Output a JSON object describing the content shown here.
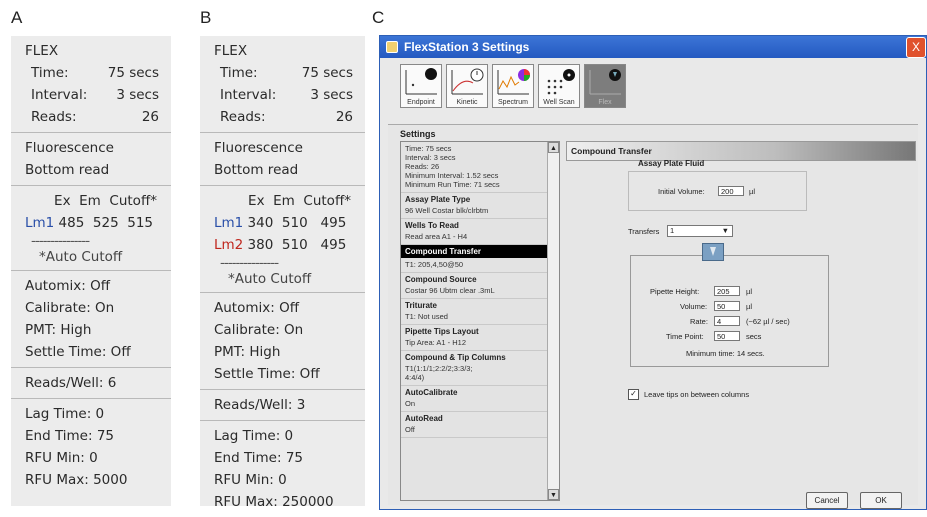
{
  "panel_letters": [
    "A",
    "B",
    "C"
  ],
  "panel_a": {
    "flex": "FLEX",
    "time_label": "Time:",
    "time_value": "75 secs",
    "interval_label": "Interval:",
    "interval_value": "3 secs",
    "reads_label": "Reads:",
    "reads_value": "26",
    "mode1": "Fluorescence",
    "mode2": "Bottom read",
    "header": "Ex  Em  Cutoff*",
    "lm1_label": "Lm1",
    "lm1_values": " 485  525  515",
    "dashes": "---------------",
    "auto_cutoff": "*Auto Cutoff",
    "automix": "Automix: Off",
    "calibrate": "Calibrate: On",
    "pmt": "PMT: High",
    "settle": "Settle Time: Off",
    "reads_well": "Reads/Well: 6",
    "lag": "Lag Time: 0",
    "end": "End Time: 75",
    "rfu_min": "RFU Min: 0",
    "rfu_max": "RFU Max: 5000"
  },
  "panel_b": {
    "flex": "FLEX",
    "time_label": "Time:",
    "time_value": "75 secs",
    "interval_label": "Interval:",
    "interval_value": "3 secs",
    "reads_label": "Reads:",
    "reads_value": "26",
    "mode1": "Fluorescence",
    "mode2": "Bottom read",
    "header": "Ex  Em  Cutoff*",
    "lm1_label": "Lm1",
    "lm1_values": " 340  510   495",
    "lm2_label": "Lm2",
    "lm2_values": " 380  510   495",
    "dashes": "---------------",
    "auto_cutoff": "*Auto Cutoff",
    "automix": "Automix: Off",
    "calibrate": "Calibrate: On",
    "pmt": "PMT: High",
    "settle": "Settle Time: Off",
    "reads_well": "Reads/Well: 3",
    "lag": "Lag Time: 0",
    "end": "End Time: 75",
    "rfu_min": "RFU Min: 0",
    "rfu_max": "RFU Max: 250000"
  },
  "window": {
    "title": "FlexStation 3 Settings",
    "close_glyph": "X",
    "toolbar": [
      "Endpoint",
      "Kinetic",
      "Spectrum",
      "Well Scan",
      "Flex"
    ],
    "settings_title": "Settings",
    "list_intro": [
      "Time: 75 secs",
      "Interval: 3 secs",
      "Reads: 26",
      "Minimum Interval: 1.52 secs",
      "Minimum Run Time: 71 secs"
    ],
    "list": [
      {
        "title": "Assay Plate Type",
        "desc": "96 Well Costar blk/clrbtm"
      },
      {
        "title": "Wells To Read",
        "desc": "Read area A1 - H4"
      },
      {
        "title": "Compound Transfer",
        "desc": "T1: 205,4,50@50"
      },
      {
        "title": "Compound Source",
        "desc": "Costar 96 Ubtm clear .3mL"
      },
      {
        "title": "Triturate",
        "desc": "T1: Not used"
      },
      {
        "title": "Pipette Tips Layout",
        "desc": "Tip Area: A1 - H12"
      },
      {
        "title": "Compound & Tip Columns",
        "desc": "T1(1:1/1;2:2/2;3:3/3;\n4:4/4)"
      },
      {
        "title": "AutoCalibrate",
        "desc": "On"
      },
      {
        "title": "AutoRead",
        "desc": "Off"
      }
    ],
    "scroll_up": "▲",
    "scroll_down": "▼",
    "content_title": "Compound Transfer",
    "apf_title": "Assay Plate Fluid",
    "initial_volume_label": "Initial Volume:",
    "initial_volume": "200",
    "initial_volume_unit": "µl",
    "transfers_label": "Transfers",
    "transfers_value": "1",
    "pipette_height_label": "Pipette Height:",
    "pipette_height": "205",
    "pipette_height_unit": "µl",
    "volume_label": "Volume:",
    "volume": "50",
    "volume_unit": "µl",
    "rate_label": "Rate:",
    "rate": "4",
    "rate_note": "(~62 µl / sec)",
    "time_point_label": "Time Point:",
    "time_point": "50",
    "time_point_unit": "secs",
    "min_time": "Minimum time: 14 secs.",
    "leave_tips": "Leave tips on between columns",
    "cancel": "Cancel",
    "ok": "OK"
  }
}
